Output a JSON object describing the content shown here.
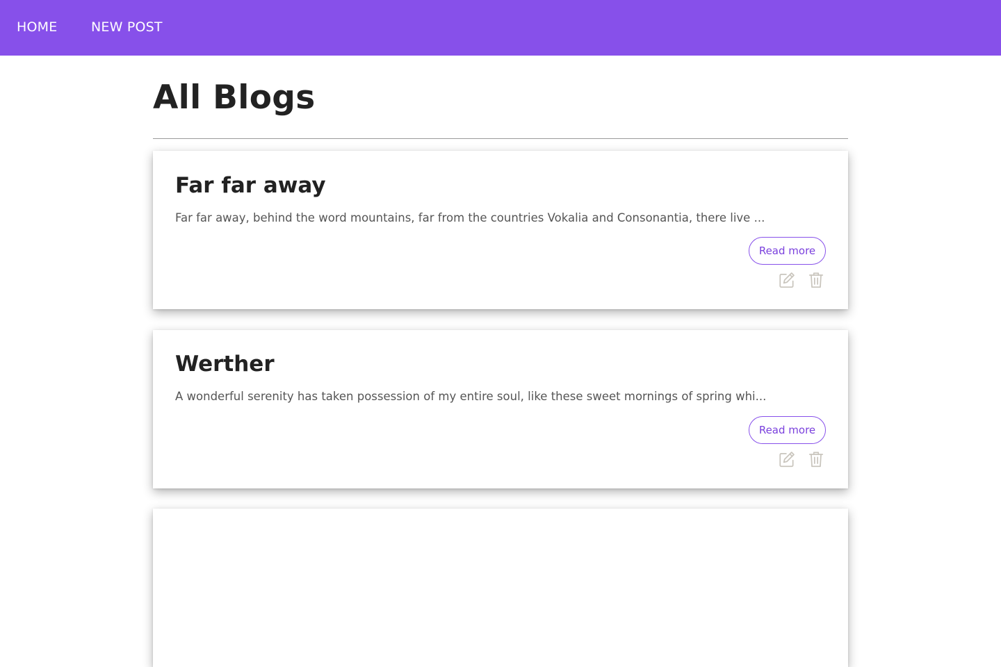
{
  "nav": {
    "home_label": "HOME",
    "new_post_label": "NEW POST"
  },
  "page": {
    "title": "All Blogs"
  },
  "posts": [
    {
      "title": "Far far away",
      "excerpt": "Far far away, behind the word mountains, far from the countries Vokalia and Consonantia, there live ...",
      "read_more_label": "Read more"
    },
    {
      "title": "Werther",
      "excerpt": "A wonderful serenity has taken possession of my entire soul, like these sweet mornings of spring whi...",
      "read_more_label": "Read more"
    },
    {
      "title": "",
      "excerpt": "",
      "read_more_label": ""
    }
  ],
  "colors": {
    "navbar": "#8750ea",
    "accent": "#7a40dd",
    "icon": "#c9c5bd"
  },
  "icons": {
    "edit": "edit-icon",
    "delete": "trash-icon"
  }
}
